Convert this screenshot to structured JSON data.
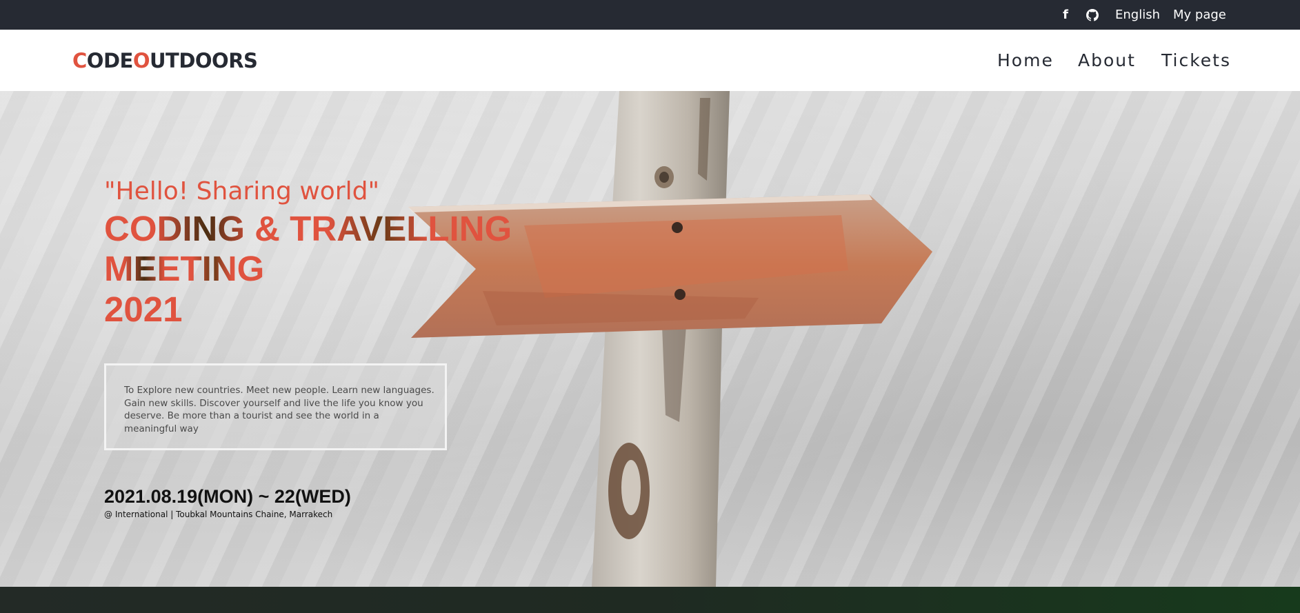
{
  "topbar": {
    "facebook_icon": "f",
    "github_icon": "github-icon",
    "language": "English",
    "mypage": "My page"
  },
  "header": {
    "logo_c": "C",
    "logo_ode": "ODE ",
    "logo_o": "O",
    "logo_utdoors": "UTDOORS",
    "nav": {
      "home": "Home",
      "about": "About",
      "tickets": "Tickets"
    }
  },
  "hero": {
    "greeting": "\"Hello! Sharing world\"",
    "headline_line1": "CODING & TRAVELLING",
    "headline_line2": "MEETING",
    "headline_line3": "2021",
    "description": "To Explore new countries. Meet new people. Learn new languages. Gain new skills. Discover yourself and live the life you know you deserve. Be more than a tourist and see the world in a meaningful way",
    "date": "2021.08.19(MON) ~ 22(WED)",
    "venue": "@ International | Toubkal Mountains Chaine, Marrakech"
  },
  "colors": {
    "accent": "#e0533f",
    "dark": "#262a33"
  }
}
